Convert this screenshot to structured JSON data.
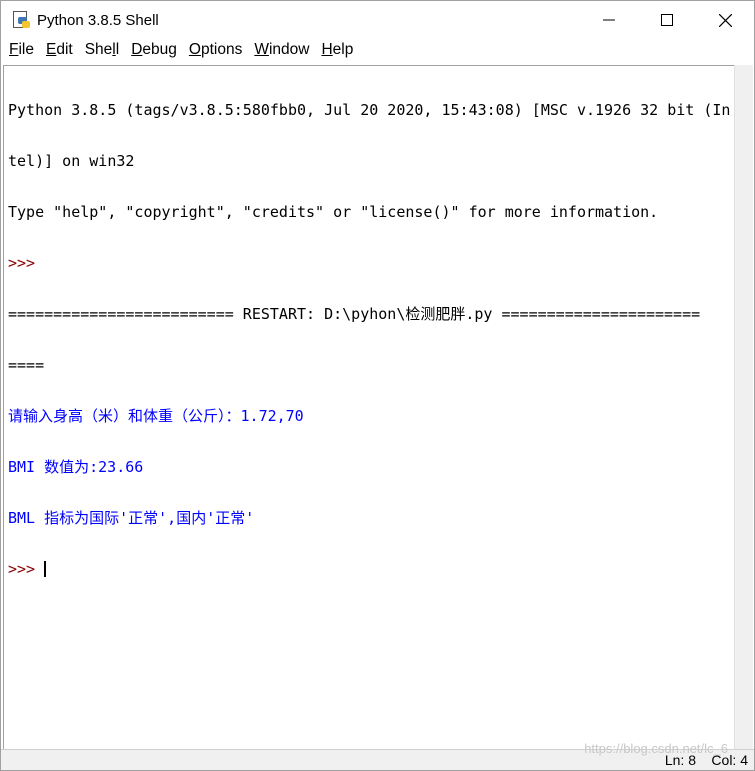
{
  "window": {
    "title": "Python 3.8.5 Shell",
    "icon": "python-idle-icon"
  },
  "menu": [
    {
      "mnemonic": "F",
      "rest": "ile"
    },
    {
      "mnemonic": "E",
      "rest": "dit"
    },
    {
      "pre": "She",
      "mnemonic": "l",
      "rest": "l"
    },
    {
      "mnemonic": "D",
      "rest": "ebug"
    },
    {
      "mnemonic": "O",
      "rest": "ptions"
    },
    {
      "mnemonic": "W",
      "rest": "indow"
    },
    {
      "mnemonic": "H",
      "rest": "elp"
    }
  ],
  "shell": {
    "lines": [
      "Python 3.8.5 (tags/v3.8.5:580fbb0, Jul 20 2020, 15:43:08) [MSC v.1926 32 bit (In",
      "tel)] on win32",
      "Type \"help\", \"copyright\", \"credits\" or \"license()\" for more information.",
      ">>>",
      "========================= RESTART: D:\\pyhon\\检测肥胖.py ======================",
      "====",
      "请输入身高（米）和体重（公斤）：1.72,70",
      "BMI 数值为:23.66",
      "BML 指标为国际'正常',国内'正常'",
      ">>> "
    ],
    "prompt_color": "#8b0000",
    "output_color": "#0000ff"
  },
  "status": {
    "ln": "Ln: 8",
    "col": "Col: 4"
  },
  "watermark": "https://blog.csdn.net/lc_6"
}
